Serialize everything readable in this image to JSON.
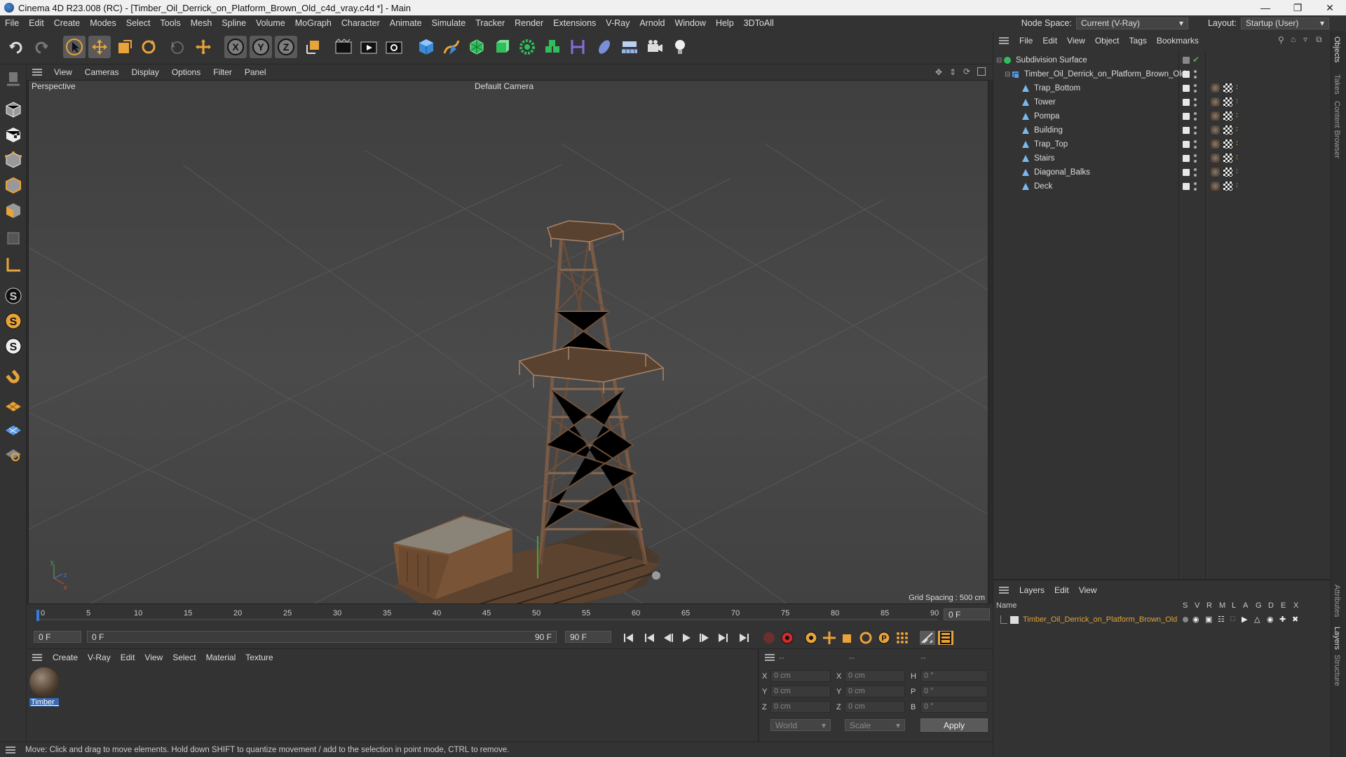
{
  "window": {
    "title": "Cinema 4D R23.008 (RC) - [Timber_Oil_Derrick_on_Platform_Brown_Old_c4d_vray.c4d *] - Main"
  },
  "menubar": {
    "items": [
      "File",
      "Edit",
      "Create",
      "Modes",
      "Select",
      "Tools",
      "Mesh",
      "Spline",
      "Volume",
      "MoGraph",
      "Character",
      "Animate",
      "Simulate",
      "Tracker",
      "Render",
      "Extensions",
      "V-Ray",
      "Arnold",
      "Window",
      "Help",
      "3DToAll"
    ],
    "node_space_label": "Node Space:",
    "node_space_value": "Current (V-Ray)",
    "layout_label": "Layout:",
    "layout_value": "Startup (User)"
  },
  "viewport": {
    "menu": [
      "View",
      "Cameras",
      "Display",
      "Options",
      "Filter",
      "Panel"
    ],
    "name": "Perspective",
    "camera": "Default Camera",
    "grid_spacing": "Grid Spacing : 500 cm"
  },
  "timeline": {
    "ticks": [
      "0",
      "5",
      "10",
      "15",
      "20",
      "25",
      "30",
      "35",
      "40",
      "45",
      "50",
      "55",
      "60",
      "65",
      "70",
      "75",
      "80",
      "85",
      "90"
    ],
    "current_frame_field": "0 F",
    "start_field": "0 F",
    "range_start": "0 F",
    "range_end": "90 F",
    "end_field": "90 F"
  },
  "material_panel": {
    "menu": [
      "Create",
      "V-Ray",
      "Edit",
      "View",
      "Select",
      "Material",
      "Texture"
    ],
    "materials": [
      {
        "name": "Timber_"
      }
    ]
  },
  "coord_panel": {
    "headers": [
      "--",
      "--",
      "--"
    ],
    "rows": [
      {
        "a": "X",
        "av": "0 cm",
        "b": "X",
        "bv": "0 cm",
        "c": "H",
        "cv": "0 °"
      },
      {
        "a": "Y",
        "av": "0 cm",
        "b": "Y",
        "bv": "0 cm",
        "c": "P",
        "cv": "0 °"
      },
      {
        "a": "Z",
        "av": "0 cm",
        "b": "Z",
        "bv": "0 cm",
        "c": "B",
        "cv": "0 °"
      }
    ],
    "world": "World",
    "scale": "Scale",
    "apply": "Apply"
  },
  "status": {
    "text": "Move: Click and drag to move elements. Hold down SHIFT to quantize movement / add to the selection in point mode, CTRL to remove."
  },
  "object_panel": {
    "menu": [
      "File",
      "Edit",
      "View",
      "Object",
      "Tags",
      "Bookmarks"
    ],
    "root": "Subdivision Surface",
    "group": "Timber_Oil_Derrick_on_Platform_Brown_Old",
    "children": [
      "Trap_Bottom",
      "Tower",
      "Pompa",
      "Building",
      "Trap_Top",
      "Stairs",
      "Diagonal_Balks",
      "Deck"
    ]
  },
  "layer_panel": {
    "menu": [
      "Layers",
      "Edit",
      "View"
    ],
    "name_header": "Name",
    "flag_headers": [
      "S",
      "V",
      "R",
      "M",
      "L",
      "A",
      "G",
      "D",
      "E",
      "X"
    ],
    "layer_name": "Timber_Oil_Derrick_on_Platform_Brown_Old",
    "layer_color": "#e0a23a"
  },
  "side_tabs": [
    "Objects",
    "Takes",
    "Content Browser",
    "Attributes",
    "Layers",
    "Structure"
  ]
}
